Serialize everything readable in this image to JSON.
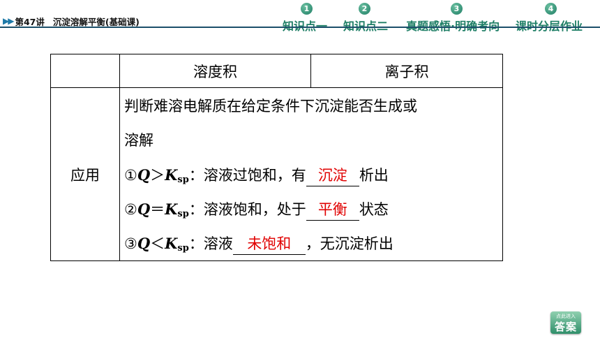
{
  "header": {
    "lesson_number": "第47讲",
    "lesson_topic": "沉淀溶解平衡(基础课)",
    "nav": [
      {
        "num": "1",
        "label": "知识点一"
      },
      {
        "num": "2",
        "label": "知识点二"
      },
      {
        "num": "3",
        "label": "真题感悟·明确考向"
      },
      {
        "num": "4",
        "label": "课时分层作业"
      }
    ]
  },
  "table": {
    "col_blank": "",
    "col1": "溶度积",
    "col2": "离子积",
    "row_label": "应用",
    "line1": "判断难溶电解质在给定条件下沉淀能否生成或",
    "line2": "溶解",
    "items": [
      {
        "num": "①",
        "q": "Q",
        "op": "＞",
        "k": "K",
        "sub": "sp",
        "text_before": "：溶液过饱和，有",
        "answer": "沉淀",
        "text_after": "析出"
      },
      {
        "num": "②",
        "q": "Q",
        "op": "＝",
        "k": "K",
        "sub": "sp",
        "text_before": "：溶液饱和，处于",
        "answer": "平衡",
        "text_after": "状态"
      },
      {
        "num": "③",
        "q": "Q",
        "op": "＜",
        "k": "K",
        "sub": "sp",
        "text_before": "：溶液",
        "answer": "未饱和",
        "text_after": "，无沉淀析出"
      }
    ]
  },
  "answer_button": {
    "top_text": "点此进入",
    "label": "答案"
  },
  "colors": {
    "accent": "#1f7f66",
    "answer": "#e00000",
    "header_line": "#1b4f6a"
  }
}
